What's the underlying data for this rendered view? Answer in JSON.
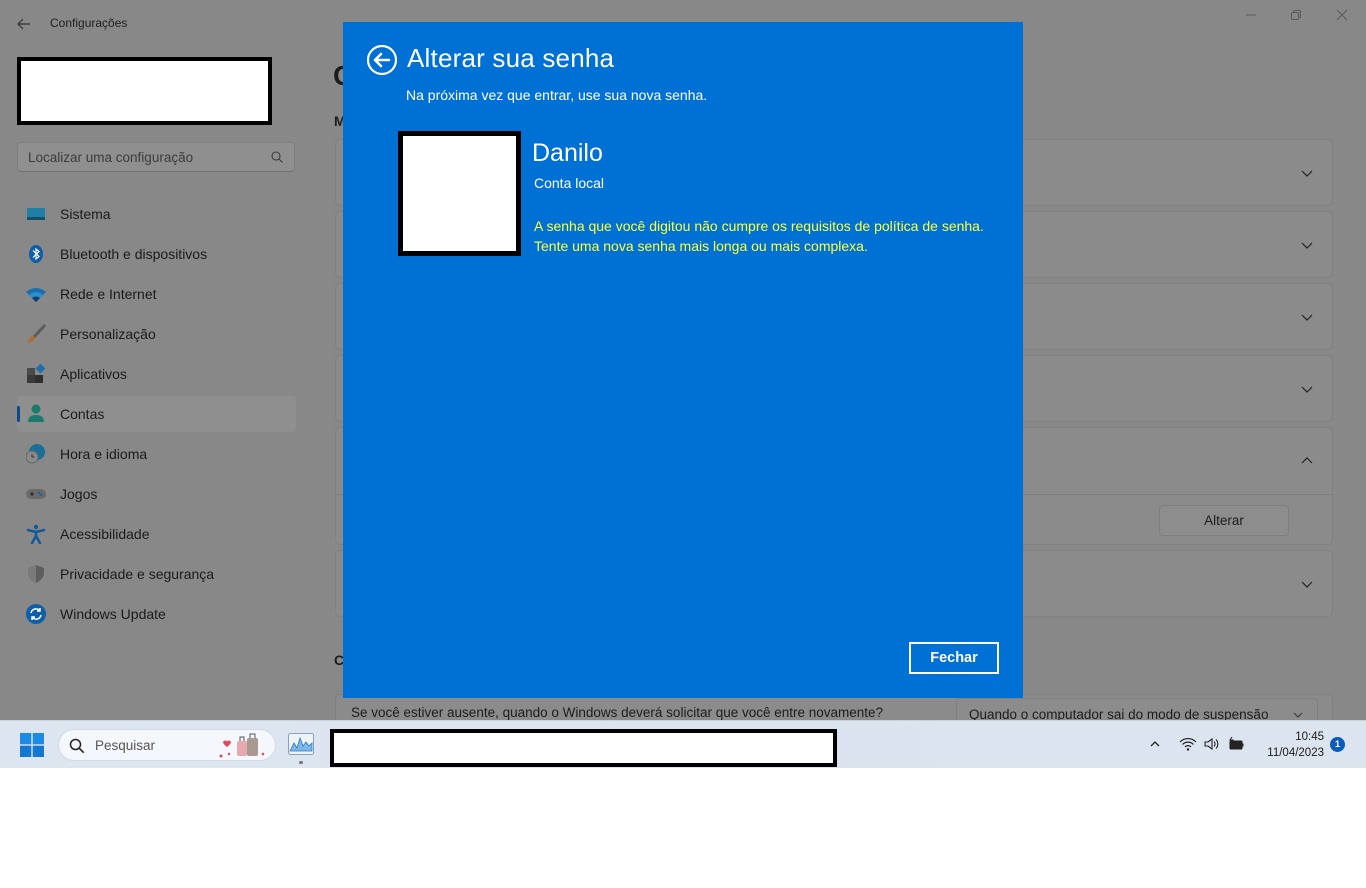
{
  "window": {
    "app_title": "Configurações",
    "controls": [
      "minimize",
      "restore",
      "close"
    ]
  },
  "sidebar": {
    "search_placeholder": "Localizar uma configuração",
    "items": [
      {
        "label": "Sistema",
        "icon": "monitor-icon",
        "active": false
      },
      {
        "label": "Bluetooth e dispositivos",
        "icon": "bluetooth-icon",
        "active": false
      },
      {
        "label": "Rede e Internet",
        "icon": "wifi-icon",
        "active": false
      },
      {
        "label": "Personalização",
        "icon": "paintbrush-icon",
        "active": false
      },
      {
        "label": "Aplicativos",
        "icon": "apps-icon",
        "active": false
      },
      {
        "label": "Contas",
        "icon": "person-icon",
        "active": true
      },
      {
        "label": "Hora e idioma",
        "icon": "clock-globe-icon",
        "active": false
      },
      {
        "label": "Jogos",
        "icon": "gamepad-icon",
        "active": false
      },
      {
        "label": "Acessibilidade",
        "icon": "accessibility-icon",
        "active": false
      },
      {
        "label": "Privacidade e segurança",
        "icon": "shield-icon",
        "active": false
      },
      {
        "label": "Windows Update",
        "icon": "update-icon",
        "active": false
      }
    ]
  },
  "main": {
    "heading_partial": "C",
    "section1_partial": "M",
    "section2_partial": "C",
    "alterar_button": "Alterar",
    "reauth_question": "Se você estiver ausente, quando o Windows deverá solicitar que você entre novamente?",
    "reauth_dropdown_value": "Quando o computador sai do modo de suspensão"
  },
  "dialog": {
    "title": "Alterar sua senha",
    "subtitle": "Na próxima vez que entrar, use sua nova senha.",
    "user_name": "Danilo",
    "account_type": "Conta local",
    "error_message": "A senha que você digitou não cumpre os requisitos de política de senha. Tente uma nova senha mais longa ou mais complexa.",
    "close_button": "Fechar",
    "colors": {
      "background": "#0071d4",
      "error_text": "#ffff3c"
    }
  },
  "taskbar": {
    "search_placeholder": "Pesquisar",
    "time": "10:45",
    "date": "11/04/2023",
    "notification_count": "1"
  }
}
